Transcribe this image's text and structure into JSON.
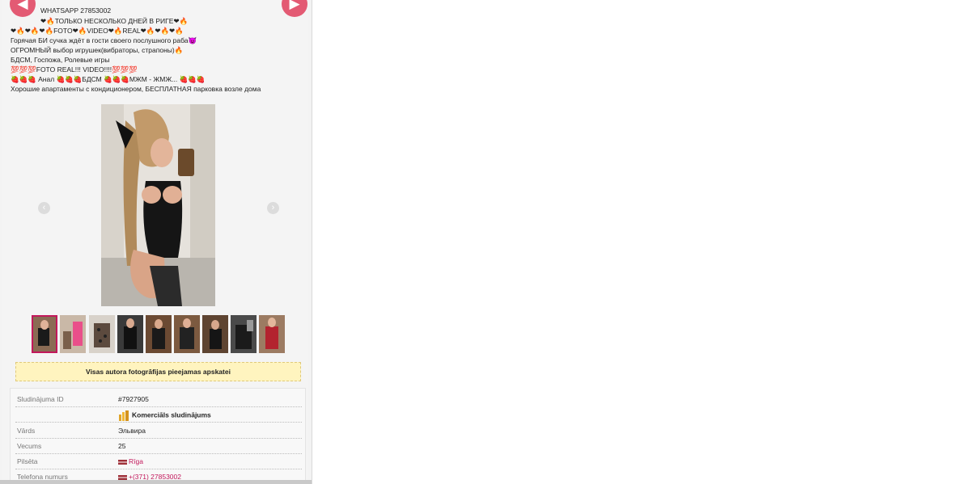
{
  "nav": {
    "prev_icon": "arrow-left-icon",
    "next_icon": "arrow-right-icon"
  },
  "description": {
    "whatsapp": "WHATSAPP 27853002",
    "headline": "❤🔥ТОЛЬКО НЕСКОЛЬКО ДНЕЙ В РИГЕ❤🔥",
    "tags_line": "❤🔥❤🔥❤🔥FOTO❤🔥VIDEO❤🔥REAL❤🔥❤🔥❤🔥",
    "lines": [
      "Горячая БИ сучка ждёт в гости своего послушного раба😈",
      "ОГРОМНЫЙ выбор игрушек(вибраторы, страпоны)🔥",
      "БДСМ, Госпожа, Ролевые игры",
      "💯💯💯FOTO REAL!!! VIDEO!!!!💯💯💯",
      "🍓🍓🍓 Анал 🍓🍓🍓БДСМ 🍓🍓🍓МЖМ - ЖМЖ... 🍓🍓🍓",
      "Хорошие апартаменты с кондиционером, БЕСПЛАТНАЯ парковка возле дома"
    ]
  },
  "gallery": {
    "prev_icon": "chevron-left-icon",
    "next_icon": "chevron-right-icon",
    "thumb_count": 9,
    "active_index": 0
  },
  "notice": "Visas autora fotogrāfijas pieejamas apskatei",
  "info": {
    "ad_id": {
      "label": "Sludinājuma ID",
      "value": "#7927905"
    },
    "commercial": {
      "value": "Komerciāls sludinājums"
    },
    "name": {
      "label": "Vārds",
      "value": "Эльвира"
    },
    "age": {
      "label": "Vecums",
      "value": "25"
    },
    "city": {
      "label": "Pilsēta",
      "value": "Rīga"
    },
    "phone": {
      "label": "Telefona numurs",
      "value": "+(371) 27853002"
    }
  },
  "colors": {
    "accent": "#e35a73",
    "link": "#c2185b",
    "notice_bg": "#fff4bf"
  }
}
